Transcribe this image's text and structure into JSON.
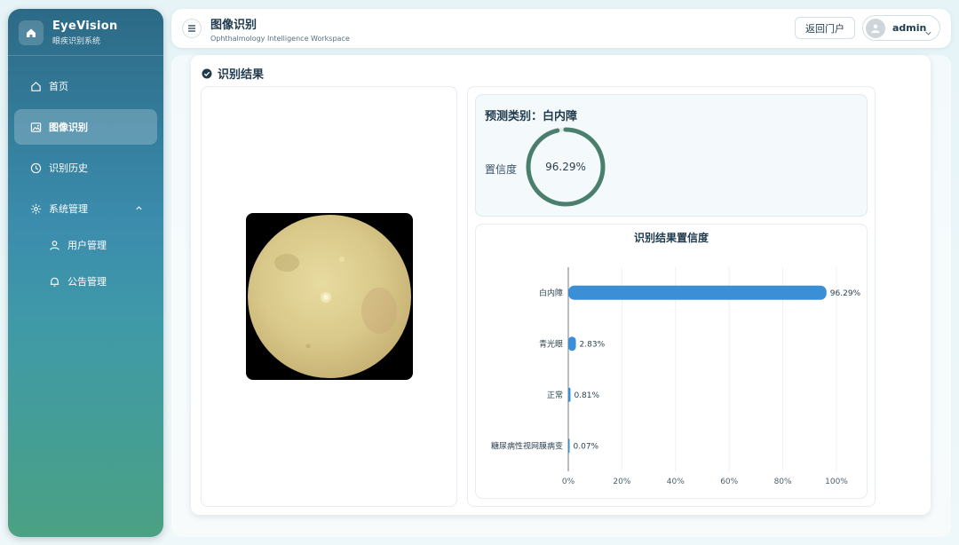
{
  "brand": {
    "title": "EyeVision",
    "subtitle": "眼疾识别系统"
  },
  "sidebar": {
    "items": [
      {
        "label": "首页",
        "icon": "home-icon"
      },
      {
        "label": "图像识别",
        "icon": "image-icon",
        "active": true
      },
      {
        "label": "识别历史",
        "icon": "clock-icon"
      },
      {
        "label": "系统管理",
        "icon": "gear-icon",
        "expanded": true
      },
      {
        "label": "用户管理",
        "icon": "user-icon"
      },
      {
        "label": "公告管理",
        "icon": "bell-icon"
      }
    ]
  },
  "header": {
    "title": "图像识别",
    "subtitle": "Ophthalmology Intelligence Workspace",
    "back_label": "返回门户",
    "user_name": "admin"
  },
  "result": {
    "section_title": "识别结果",
    "prediction_label": "预测类别：白内障",
    "confidence_label": "置信度",
    "confidence_text": "96.29%",
    "confidence_value": 0.9629
  },
  "colors": {
    "accent": "#3a8fd6",
    "ring": "#4a7f6e",
    "sidebar_top": "#2c6a86",
    "sidebar_bottom": "#4aa183"
  },
  "chart_data": {
    "type": "bar",
    "orientation": "horizontal",
    "title": "识别结果置信度",
    "categories": [
      "白内障",
      "青光眼",
      "正常",
      "糖尿病性视网膜病变"
    ],
    "values": [
      96.29,
      2.83,
      0.81,
      0.07
    ],
    "value_labels": [
      "96.29%",
      "2.83%",
      "0.81%",
      "0.07%"
    ],
    "xlim": [
      0,
      100
    ],
    "xticks": [
      "0%",
      "20%",
      "40%",
      "60%",
      "80%",
      "100%"
    ],
    "grid": true
  }
}
